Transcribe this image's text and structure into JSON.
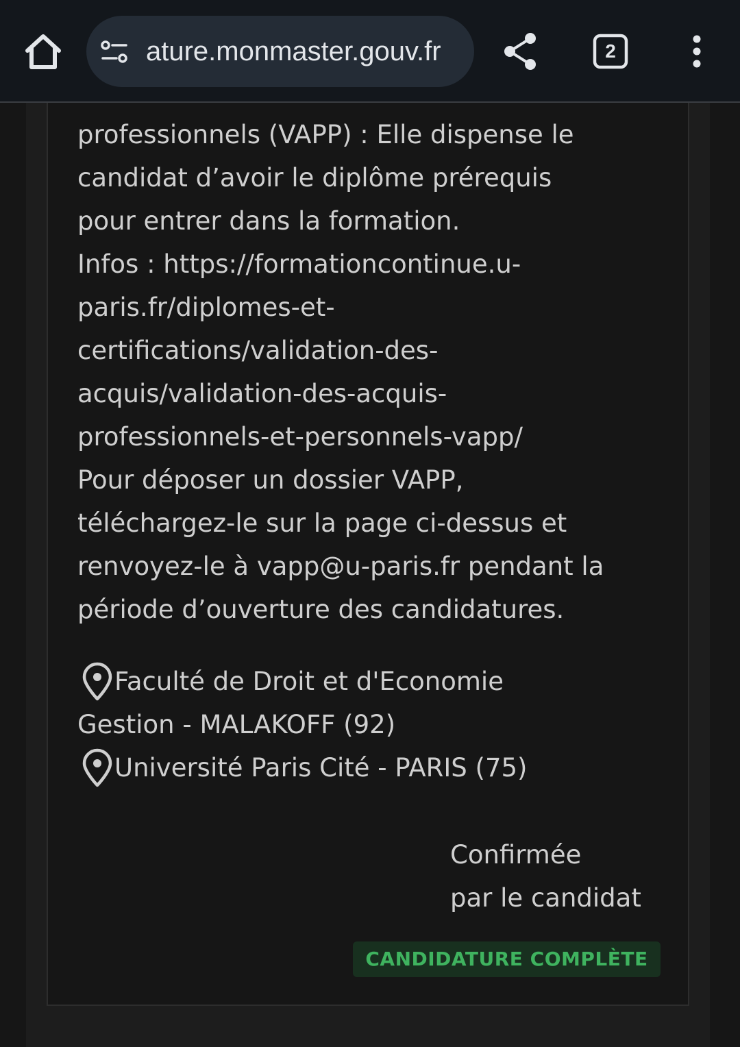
{
  "browser": {
    "url": "ature.monmaster.gouv.fr",
    "tab_count": "2",
    "icons": [
      "home-icon",
      "site-settings-icon",
      "share-icon",
      "tabs-icon",
      "more-vert-icon"
    ]
  },
  "formation": {
    "description_lines": [
      "professionnels (VAPP) : Elle dispense le",
      "candidat d’avoir le diplôme prérequis",
      "pour entrer dans la formation.",
      "Infos : https://formationcontinue.u-",
      "paris.fr/diplomes-et-",
      "certifications/validation-des-",
      "acquis/validation-des-acquis-",
      "professionnels-et-personnels-vapp/",
      "Pour déposer un dossier VAPP,",
      "téléchargez-le sur la page ci-dessus et",
      "renvoyez-le à vapp@u-paris.fr pendant la",
      "période d’ouverture des candidatures."
    ],
    "locations": [
      {
        "line1": "Faculté de Droit et d'Economie",
        "line2": "Gestion - MALAKOFF (92)"
      },
      {
        "line1": "Université Paris Cité - PARIS (75)"
      }
    ],
    "status_lines": [
      "Confirmée",
      "par le candidat"
    ],
    "badge": "CANDIDATURE COMPLÈTE"
  },
  "colors": {
    "toolbar_bg": "#13171c",
    "url_pill_bg": "#242c36",
    "page_bg": "#161616",
    "text": "#cfcfcf",
    "badge_bg": "#18301f",
    "badge_text": "#3fb35f"
  }
}
